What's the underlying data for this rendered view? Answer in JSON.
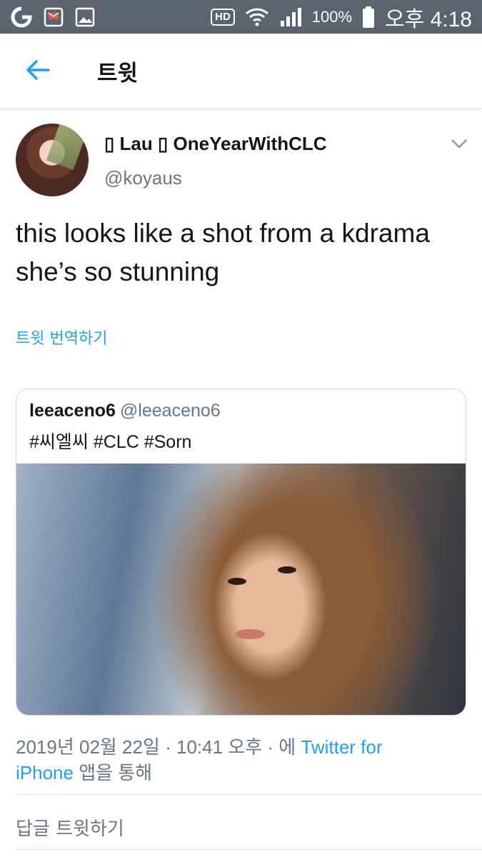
{
  "status_bar": {
    "battery": "100%",
    "time": "오후 4:18",
    "hd_label": "HD",
    "icons": [
      "app-g-icon",
      "message-icon",
      "gallery-icon",
      "hd-voice-icon",
      "wifi-icon",
      "signal-icon",
      "battery-icon"
    ]
  },
  "header": {
    "title": "트윗",
    "back_icon": "back-arrow-icon"
  },
  "tweet": {
    "display_name": "▯ Lau ▯ OneYearWithCLC",
    "username": "@koyaus",
    "text": "this looks like a shot from a kdrama she’s so stunning",
    "translate_label": "트윗 번역하기",
    "more_icon": "chevron-down-icon"
  },
  "quoted_tweet": {
    "name": "leeaceno6",
    "handle": "@leeaceno6",
    "text": "#씨엘씨 #CLC #Sorn"
  },
  "meta": {
    "date": "2019년 02월 22일 · 10:41 오후 · 에 ",
    "source_link_1": "Twitter for",
    "source_link_2": "iPhone",
    "suffix": " 앱을 통해"
  },
  "reply": {
    "label": "답글 트윗하기"
  },
  "colors": {
    "accent": "#1da1f2",
    "status_bar": "#5a6470",
    "secondary_text": "#657786"
  }
}
